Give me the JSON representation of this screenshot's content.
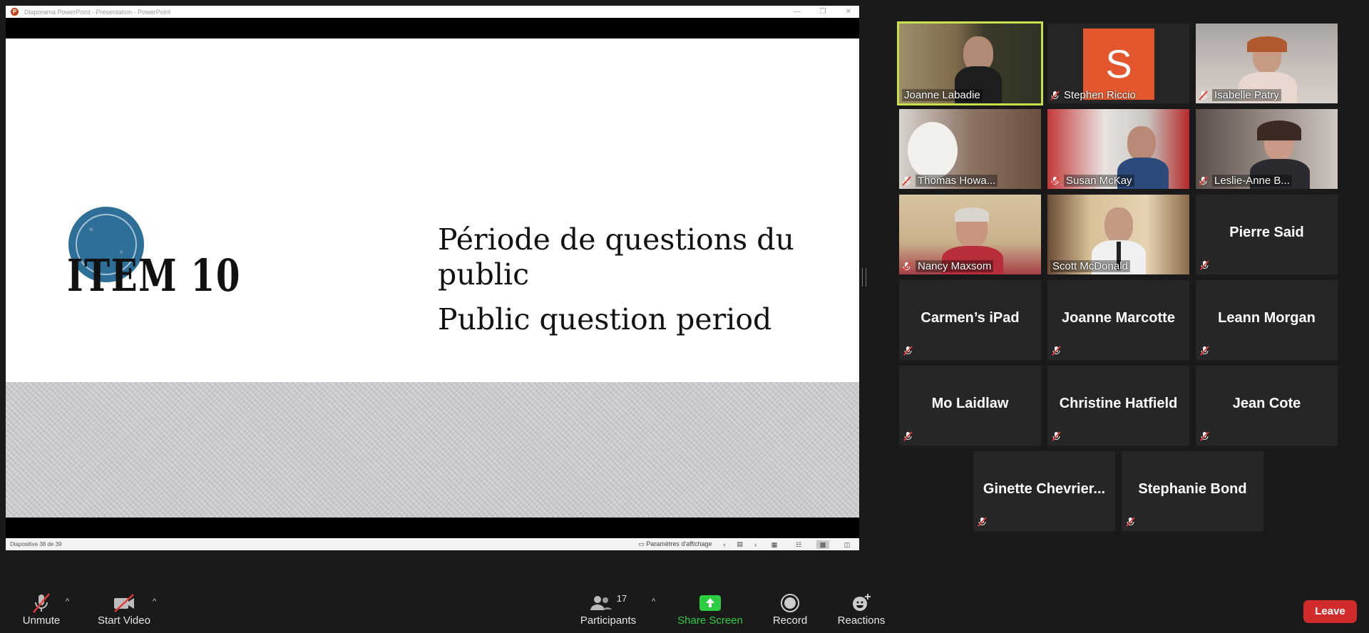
{
  "powerpoint": {
    "window_title": "Diaporama PowerPoint  -  Présentation - PowerPoint",
    "logo_letter": "P",
    "min_glyph": "—",
    "restore_glyph": "❐",
    "close_glyph": "✕",
    "slide": {
      "item_label": "ITEM 10",
      "title_fr": "Période de questions du public",
      "title_en": "Public question period"
    },
    "status": {
      "slide_number": "Diapositive 38 de 39",
      "display_settings": "Paramètres d'affichage"
    }
  },
  "participants": [
    {
      "name": "Joanne Labadie",
      "type": "video",
      "active_speaker": true,
      "muted": false
    },
    {
      "name": "Stephen Riccio",
      "type": "avatar",
      "avatar_letter": "S",
      "muted": true
    },
    {
      "name": "Isabelle Patry",
      "type": "video",
      "muted": true
    },
    {
      "name": "Thomas Howa...",
      "type": "video",
      "muted": true
    },
    {
      "name": "Susan McKay",
      "type": "video",
      "muted": true
    },
    {
      "name": "Leslie-Anne B...",
      "type": "video",
      "muted": true
    },
    {
      "name": "Nancy Maxsom",
      "type": "video",
      "muted": true
    },
    {
      "name": "Scott McDonald",
      "type": "video",
      "muted": false
    },
    {
      "name": "Pierre Said",
      "type": "name",
      "muted": true
    },
    {
      "name": "Carmen’s iPad",
      "type": "name",
      "muted": true
    },
    {
      "name": "Joanne Marcotte",
      "type": "name",
      "muted": true
    },
    {
      "name": "Leann Morgan",
      "type": "name",
      "muted": true
    },
    {
      "name": "Mo Laidlaw",
      "type": "name",
      "muted": true
    },
    {
      "name": "Christine Hatfield",
      "type": "name",
      "muted": true
    },
    {
      "name": "Jean Cote",
      "type": "name",
      "muted": true
    },
    {
      "name": "Ginette  Chevrier...",
      "type": "name",
      "muted": true
    },
    {
      "name": "Stephanie Bond",
      "type": "name",
      "muted": true
    }
  ],
  "toolbar": {
    "unmute": "Unmute",
    "start_video": "Start Video",
    "participants": "Participants",
    "participants_count": "17",
    "share_screen": "Share Screen",
    "record": "Record",
    "reactions": "Reactions",
    "leave": "Leave",
    "caret": "^"
  },
  "colors": {
    "active_speaker_border": "#c8e04a",
    "share_green": "#2ecc40",
    "leave_red": "#d22b2b",
    "avatar_orange": "#e4572e"
  }
}
